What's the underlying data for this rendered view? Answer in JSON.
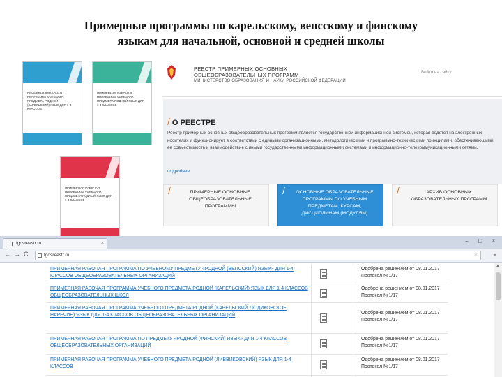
{
  "slide": {
    "title_line1": "Примерные программы по карельскому, вепсскому и финскому",
    "title_line2": "языкам для начальной, основной и средней школы"
  },
  "covers": [
    {
      "accent": "#2f9fd0",
      "text": "ПРИМЕРНАЯ РАБОЧАЯ ПРОГРАММА УЧЕБНОГО ПРЕДМЕТА РОДНОЙ (КАРЕЛЬСКИЙ) ЯЗЫК ДЛЯ 1-4 КЛАССОВ"
    },
    {
      "accent": "#3ab39a",
      "text": "ПРИМЕРНАЯ РАБОЧАЯ ПРОГРАММА УЧЕБНОГО ПРЕДМЕТА РОДНОЙ ЯЗЫК ДЛЯ 1-4 КЛАССОВ"
    },
    {
      "accent": "#e0344a",
      "text": "ПРИМЕРНАЯ РАБОЧАЯ ПРОГРАММА УЧЕБНОГО ПРЕДМЕТА РОДНОЙ ЯЗЫК ДЛЯ 1-4 КЛАССОВ"
    }
  ],
  "site": {
    "title": "РЕЕСТР ПРИМЕРНЫХ ОСНОВНЫХ ОБЩЕОБРАЗОВАТЕЛЬНЫХ ПРОГРАММ",
    "ministry": "МИНИСТЕРСТВО ОБРАЗОВАНИЯ И НАУКИ РОССИЙСКОЙ ФЕДЕРАЦИИ",
    "login": "Войти на сайту",
    "about_heading": "О РЕЕСТРЕ",
    "about_text": "Реестр примерных основных общеобразовательных программ является государственной информационной системой, которая ведется на электронных носителях и функционирует в соответствии с едиными организационными, методологическими и программно-техническими принципами, обеспечивающими ее совместимость и взаимодействие с иными государственными информационными системами и информационно-телекоммуникационными сетями.",
    "more": "подробнее",
    "tiles": [
      {
        "label": "ПРИМЕРНЫЕ ОСНОВНЫЕ ОБЩЕОБРАЗОВАТЕЛЬНЫЕ ПРОГРАММЫ",
        "active": false
      },
      {
        "label": "ОСНОВНЫЕ ОБРАЗОВАТЕЛЬНЫЕ ПРОГРАММЫ ПО УЧЕБНЫМ ПРЕДМЕТАМ, КУРСАМ, ДИСЦИПЛИНАМ (МОДУЛЯМ)",
        "active": true
      },
      {
        "label": "АРХИВ ОСНОВНЫХ ОБРАЗОВАТЕЛЬНЫХ ПРОГРАММ",
        "active": false
      }
    ]
  },
  "browser": {
    "tab_title": "fgosreestr.ru",
    "tab_close": "×",
    "window_controls": "– ▢ ×",
    "nav_back": "←",
    "nav_forward": "→",
    "nav_reload": "C",
    "address": "fgosreestr.ru",
    "bookmark_star": "☆",
    "menu": "≡",
    "scroll_up": "▲"
  },
  "table": {
    "rows": [
      {
        "program": "ПРИМЕРНАЯ РАБОЧАЯ ПРОГРАММА ПО УЧЕБНОМУ ПРЕДМЕТУ «РОДНОЙ (ВЕПССКИЙ) ЯЗЫК» ДЛЯ 1-4 КЛАССОВ ОБЩЕОБРАЗОВАТЕЛЬНЫХ ОРГАНИЗАЦИЙ",
        "status": "Одобрена решением от 08.01.2017 Протокол №1/17"
      },
      {
        "program": "ПРИМЕРНАЯ РАБОЧАЯ ПРОГРАММА УЧЕБНОГО ПРЕДМЕТА РОДНОЙ (КАРЕЛЬСКИЙ) ЯЗЫК ДЛЯ 1-4 КЛАССОВ ОБЩЕОБРАЗОВАТЕЛЬНЫХ ШКОЛ",
        "status": "Одобрена решением от 08.01.2017 Протокол №1/17"
      },
      {
        "program": "ПРИМЕРНАЯ РАБОЧАЯ ПРОГРАММА УЧЕБНОГО ПРЕДМЕТА РОДНОЙ (КАРЕЛЬСКИЙ ЛЮДИКОВСКОЕ НАРЕЧИЕ) ЯЗЫК ДЛЯ 1-4 КЛАССОВ ОБЩЕОБРАЗОВАТЕЛЬНЫХ ОРГАНИЗАЦИЙ",
        "status": "Одобрена решением от 08.01.2017 Протокол №1/17"
      },
      {
        "program": "ПРИМЕРНАЯ РАБОЧАЯ ПРОГРАММА ПО ПРЕДМЕТУ «РОДНОЙ (ФИНСКИЙ) ЯЗЫК» ДЛЯ 1-4 КЛАССОВ ОБЩЕОБРАЗОВАТЕЛЬНЫХ ОРГАНИЗАЦИЙ",
        "status": "Одобрена решением от 08.01.2017 Протокол №1/17"
      },
      {
        "program": "ПРИМЕРНАЯ РАБОЧАЯ ПРОГРАММА УЧЕБНОГО ПРЕДМЕТА РОДНОЙ (ЛИВВИКОВСКИЙ) ЯЗЫК ДЛЯ 1-4 КЛАССОВ",
        "status": "Одобрена решением от 08.01.2017 Протокол №1/17"
      }
    ]
  }
}
